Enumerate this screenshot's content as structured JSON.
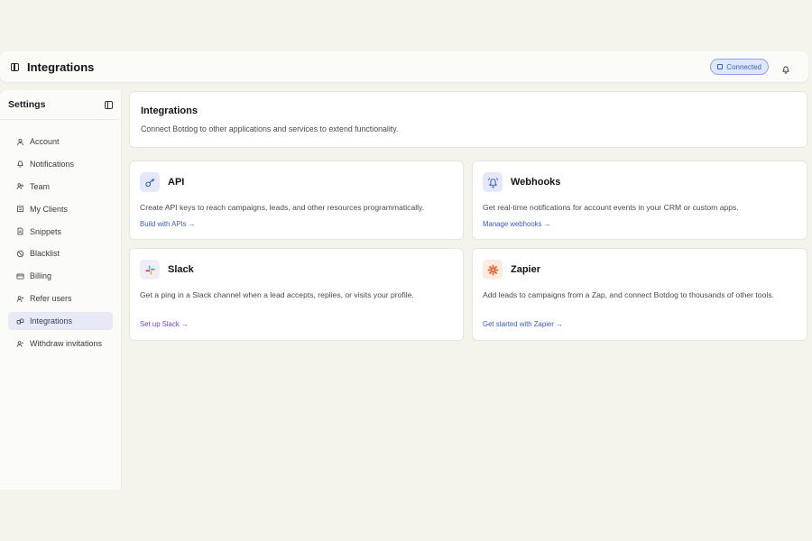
{
  "header": {
    "title": "Integrations",
    "status_badge": "Connected"
  },
  "sidebar": {
    "title": "Settings",
    "items": [
      {
        "label": "Account",
        "icon": "user-icon"
      },
      {
        "label": "Notifications",
        "icon": "bell-icon"
      },
      {
        "label": "Team",
        "icon": "team-icon"
      },
      {
        "label": "My Clients",
        "icon": "clients-icon"
      },
      {
        "label": "Snippets",
        "icon": "document-icon"
      },
      {
        "label": "Blacklist",
        "icon": "ban-icon"
      },
      {
        "label": "Billing",
        "icon": "credit-card-icon"
      },
      {
        "label": "Refer users",
        "icon": "user-plus-icon"
      },
      {
        "label": "Integrations",
        "icon": "link-icon",
        "active": true
      },
      {
        "label": "Withdraw invitations",
        "icon": "user-minus-icon"
      }
    ]
  },
  "main": {
    "title": "Integrations",
    "description": "Connect Botdog to other applications and services to extend functionality.",
    "integrations": [
      {
        "name": "API",
        "description": "Create API keys to reach campaigns, leads, and other resources programmatically.",
        "link": "Build with APIs →"
      },
      {
        "name": "Webhooks",
        "description": "Get real-time notifications for account events in your CRM or custom apps.",
        "link": "Manage webhooks →"
      },
      {
        "name": "Slack",
        "description": "Get a ping in a Slack channel when a lead accepts, replies, or visits your profile.",
        "link": "Set up Slack →"
      },
      {
        "name": "Zapier",
        "description": "Add leads to campaigns from a Zap, and connect Botdog to thousands of other tools.",
        "link": "Get started with Zapier →"
      }
    ]
  },
  "colors": {
    "accent": "#3a5db7",
    "slack_link": "#7a3fc2",
    "zapier": "#e8622a",
    "active_nav_bg": "#e7e9f7"
  }
}
